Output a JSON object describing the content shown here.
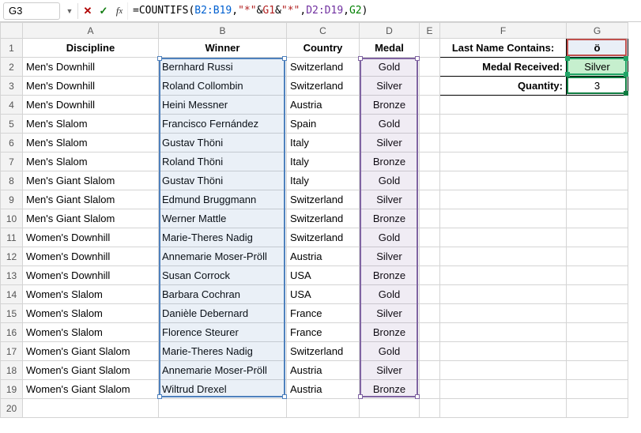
{
  "nameBox": "G3",
  "formula": {
    "prefix": "=COUNTIFS(",
    "r1": "B2:B19",
    "c1": ",",
    "arg2a": "\"*\"",
    "amp1": "&",
    "g1": "G1",
    "amp2": "&",
    "arg2b": "\"*\"",
    "c2": ",",
    "r2": "D2:D19",
    "c3": ",",
    "g2": "G2",
    "suffix": ")"
  },
  "columns": [
    "A",
    "B",
    "C",
    "D",
    "E",
    "F",
    "G"
  ],
  "headers": {
    "A": "Discipline",
    "B": "Winner",
    "C": "Country",
    "D": "Medal"
  },
  "side": {
    "lbl1": "Last Name Contains:",
    "val1": "ö",
    "lbl2": "Medal Received:",
    "val2": "Silver",
    "lbl3": "Quantity:",
    "val3": "3"
  },
  "rows": [
    {
      "a": "Men's Downhill",
      "b": "Bernhard Russi",
      "c": "Switzerland",
      "d": "Gold"
    },
    {
      "a": "Men's Downhill",
      "b": "Roland Collombin",
      "c": "Switzerland",
      "d": "Silver"
    },
    {
      "a": "Men's Downhill",
      "b": "Heini Messner",
      "c": "Austria",
      "d": "Bronze"
    },
    {
      "a": "Men's Slalom",
      "b": "Francisco Fernández",
      "c": "Spain",
      "d": "Gold"
    },
    {
      "a": "Men's Slalom",
      "b": "Gustav Thöni",
      "c": "Italy",
      "d": "Silver"
    },
    {
      "a": "Men's Slalom",
      "b": "Roland Thöni",
      "c": "Italy",
      "d": "Bronze"
    },
    {
      "a": "Men's Giant Slalom",
      "b": "Gustav Thöni",
      "c": "Italy",
      "d": "Gold"
    },
    {
      "a": "Men's Giant Slalom",
      "b": "Edmund Bruggmann",
      "c": "Switzerland",
      "d": "Silver"
    },
    {
      "a": "Men's Giant Slalom",
      "b": "Werner Mattle",
      "c": "Switzerland",
      "d": "Bronze"
    },
    {
      "a": "Women's Downhill",
      "b": "Marie-Theres Nadig",
      "c": "Switzerland",
      "d": "Gold"
    },
    {
      "a": "Women's Downhill",
      "b": "Annemarie Moser-Pröll",
      "c": "Austria",
      "d": "Silver"
    },
    {
      "a": "Women's Downhill",
      "b": "Susan Corrock",
      "c": "USA",
      "d": "Bronze"
    },
    {
      "a": "Women's Slalom",
      "b": "Barbara Cochran",
      "c": "USA",
      "d": "Gold"
    },
    {
      "a": "Women's Slalom",
      "b": "Danièle Debernard",
      "c": "France",
      "d": "Silver"
    },
    {
      "a": "Women's Slalom",
      "b": "Florence Steurer",
      "c": "France",
      "d": "Bronze"
    },
    {
      "a": "Women's Giant Slalom",
      "b": "Marie-Theres Nadig",
      "c": "Switzerland",
      "d": "Gold"
    },
    {
      "a": "Women's Giant Slalom",
      "b": "Annemarie Moser-Pröll",
      "c": "Austria",
      "d": "Silver"
    },
    {
      "a": "Women's Giant Slalom",
      "b": "Wiltrud Drexel",
      "c": "Austria",
      "d": "Bronze"
    }
  ]
}
